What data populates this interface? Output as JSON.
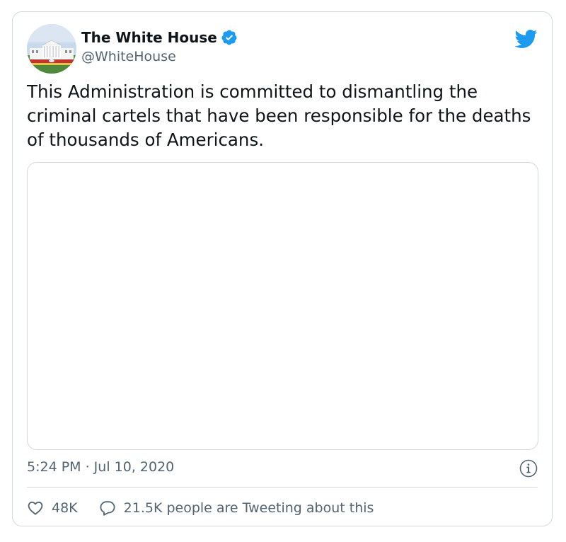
{
  "author": {
    "display_name": "The White House",
    "handle": "@WhiteHouse",
    "verified": true,
    "avatar": "white-house-building-photo"
  },
  "tweet": {
    "text": "This Administration is committed to dismantling the criminal cartels that have been responsible for the deaths of thousands of Americans."
  },
  "meta": {
    "timestamp": "5:24 PM · Jul 10, 2020"
  },
  "actions": {
    "likes": "48K",
    "conversation": "21.5K people are Tweeting about this"
  },
  "icons": {
    "brand": "twitter-bird-icon",
    "verified": "verified-badge-icon",
    "info": "info-icon",
    "like": "heart-icon",
    "reply": "speech-bubble-icon"
  },
  "colors": {
    "brand_blue": "#1d9bf0",
    "text_primary": "#0f1419",
    "text_secondary": "#536471",
    "border": "#cfd9de"
  }
}
